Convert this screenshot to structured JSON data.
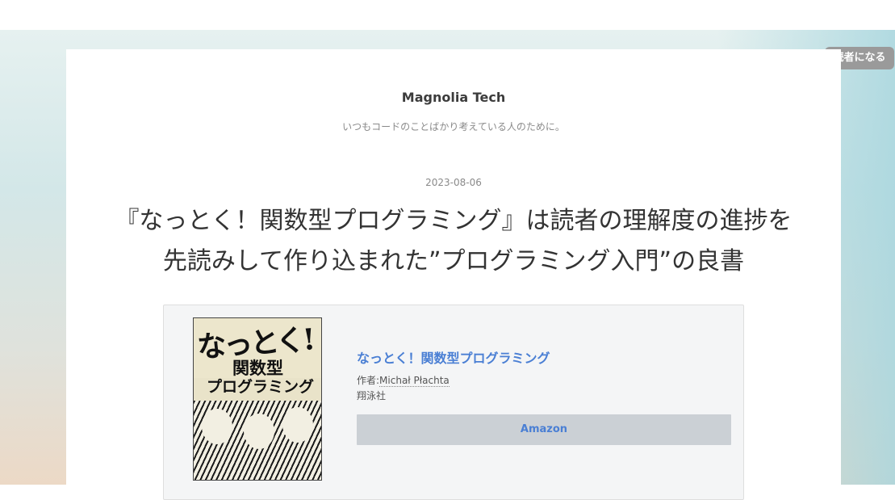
{
  "subscribe_label": "読者になる",
  "blog": {
    "title": "Magnolia Tech",
    "description": "いつもコードのことばかり考えている人のために。"
  },
  "entry": {
    "date": "2023-08-06",
    "title_line1": "『なっとく！関数型プログラミング』は読者の理解度の進捗を",
    "title_line2": "先読みして作り込まれた”プログラミング入門”の良書"
  },
  "book": {
    "title": "なっとく！関数型プログラミング",
    "author_prefix": "作者:",
    "author": "Michał Płachta",
    "publisher": "翔泳社",
    "buy_button": "Amazon",
    "cover_text_main": "なっとく!",
    "cover_text_sub1": "関数型",
    "cover_text_sub2": "プログラミング"
  },
  "colors": {
    "link": "#4a7fd4",
    "subscribe_bg": "#9a9a9a",
    "button_bg": "#cbd0d5"
  }
}
